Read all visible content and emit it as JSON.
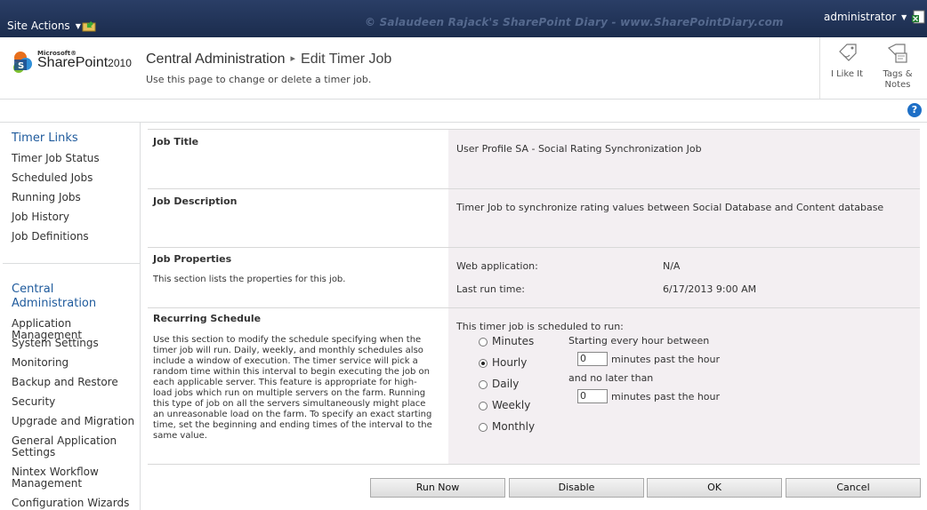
{
  "topbar": {
    "site_actions": "Site Actions",
    "watermark": "© Salaudeen Rajack's SharePoint Diary - www.SharePointDiary.com",
    "user": "administrator"
  },
  "header": {
    "logo_ms": "Microsoft®",
    "logo_product": "SharePoint",
    "logo_year": "2010",
    "breadcrumb_root": "Central Administration",
    "breadcrumb_current": "Edit Timer Job",
    "subtitle": "Use this page to change or delete a timer job.",
    "i_like_it": "I Like It",
    "tags_notes_1": "Tags &",
    "tags_notes_2": "Notes"
  },
  "leftnav": {
    "timer_links_head": "Timer Links",
    "timer_links": [
      "Timer Job Status",
      "Scheduled Jobs",
      "Running Jobs",
      "Job History",
      "Job Definitions"
    ],
    "ca_head_1": "Central",
    "ca_head_2": "Administration",
    "ca_links": [
      "Application Management",
      "System Settings",
      "Monitoring",
      "Backup and Restore",
      "Security",
      "Upgrade and Migration",
      "General Application",
      "Settings",
      "Nintex Workflow",
      "Management",
      "Configuration Wizards"
    ]
  },
  "form": {
    "job_title_label": "Job Title",
    "job_title_value": "User Profile SA - Social Rating Synchronization Job",
    "job_desc_label": "Job Description",
    "job_desc_value": "Timer Job to synchronize rating values between Social Database and Content database",
    "props_label": "Job Properties",
    "props_desc": "This section lists the properties for this job.",
    "web_app_label": "Web application:",
    "web_app_value": "N/A",
    "last_run_label": "Last run time:",
    "last_run_value": "6/17/2013 9:00 AM",
    "schedule_label": "Recurring Schedule",
    "schedule_desc": "Use this section to modify the schedule specifying when the timer job will run. Daily, weekly, and monthly schedules also include a window of execution. The timer service will pick a random time within this interval to begin executing the job on each applicable server. This feature is appropriate for high-load jobs which run on multiple servers on the farm. Running this type of job on all the servers simultaneously might place an unreasonable load on the farm. To specify an exact starting time, set the beginning and ending times of the interval to the same value.",
    "scheduled_to_run": "This timer job is scheduled to run:",
    "options": [
      "Minutes",
      "Hourly",
      "Daily",
      "Weekly",
      "Monthly"
    ],
    "selected_option": "Hourly",
    "starting_label": "Starting every hour between",
    "start_value": "0",
    "minutes_past_1": "minutes past the hour",
    "no_later_label": "and no later than",
    "end_value": "0",
    "minutes_past_2": "minutes past the hour"
  },
  "buttons": {
    "run_now": "Run Now",
    "disable": "Disable",
    "ok": "OK",
    "cancel": "Cancel"
  }
}
